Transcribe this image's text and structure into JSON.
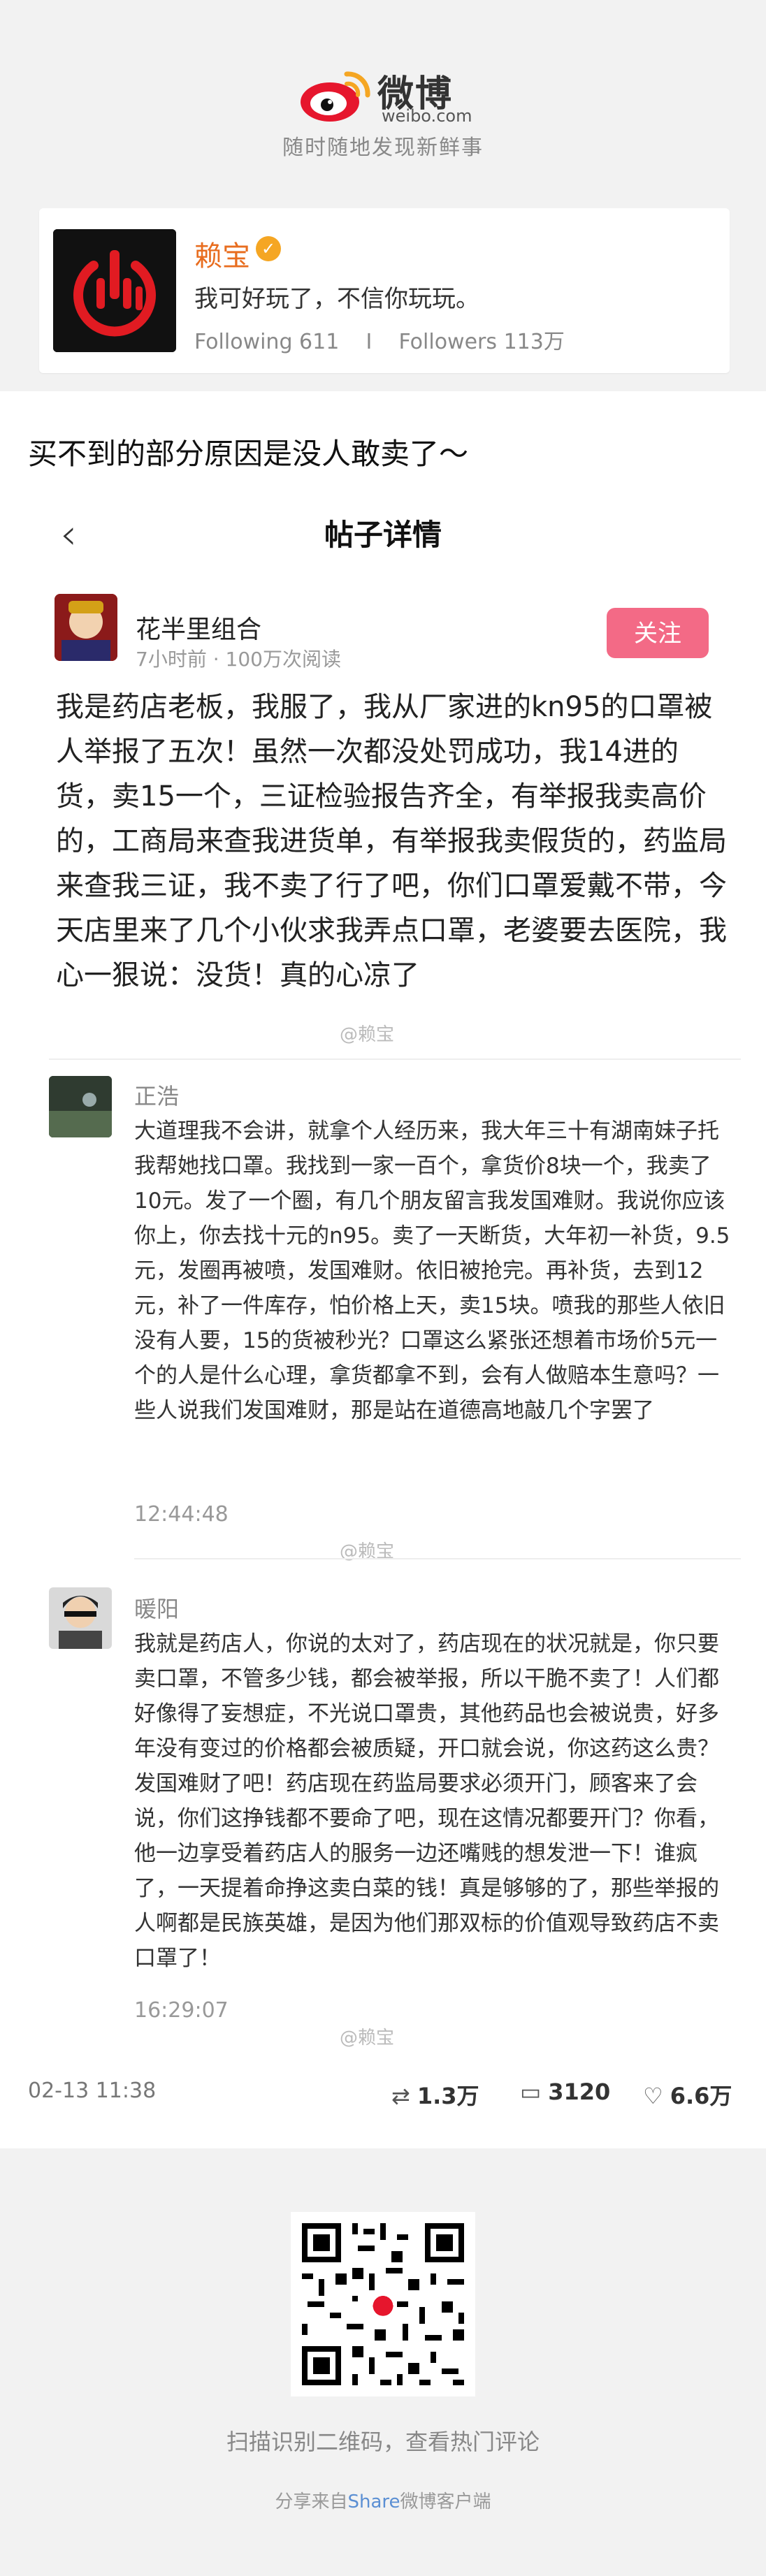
{
  "header": {
    "brand_word": "微博",
    "brand_domain": "weibo.com",
    "slogan": "随时随地发现新鲜事"
  },
  "profile": {
    "name": "赖宝",
    "verified_icon": "verified-badge-icon",
    "bio": "我可好玩了，不信你玩玩。",
    "following_label": "Following",
    "following_count": "611",
    "separator": "I",
    "followers_label": "Followers",
    "followers_count": "113万"
  },
  "post": {
    "headline": "买不到的部分原因是没人敢卖了～",
    "nav_back_icon": "chevron-left-icon",
    "nav_title": "帖子详情",
    "op": {
      "name": "花半里组合",
      "meta": "7小时前 · 100万次阅读",
      "follow_label": "关注",
      "body": "我是药店老板，我服了，我从厂家进的kn95的口罩被人举报了五次！虽然一次都没处罚成功，我14进的货，卖15一个，三证检验报告齐全，有举报我卖高价的，工商局来查我进货单，有举报我卖假货的，药监局来查我三证，我不卖了行了吧，你们口罩爱戴不带，今天店里来了几个小伙求我弄点口罩，老婆要去医院，我心一狠说：没货！真的心凉了"
    },
    "watermark": "@赖宝",
    "comments": [
      {
        "name": "正浩",
        "body": "大道理我不会讲，就拿个人经历来，我大年三十有湖南妹子托我帮她找口罩。我找到一家一百个，拿货价8块一个，我卖了10元。发了一个圈，有几个朋友留言我发国难财。我说你应该你上，你去找十元的n95。卖了一天断货，大年初一补货，9.5元，发圈再被喷，发国难财。依旧被抢完。再补货，去到12元，补了一件库存，怕价格上天，卖15块。喷我的那些人依旧没有人要，15的货被秒光？口罩这么紧张还想着市场价5元一个的人是什么心理，拿货都拿不到，会有人做赔本生意吗？一些人说我们发国难财，那是站在道德高地敲几个字罢了",
        "time": "12:44:48"
      },
      {
        "name": "暖阳",
        "body": "我就是药店人，你说的太对了，药店现在的状况就是，你只要卖口罩，不管多少钱，都会被举报，所以干脆不卖了！人们都好像得了妄想症，不光说口罩贵，其他药品也会被说贵，好多年没有变过的价格都会被质疑，开口就会说，你这药这么贵？发国难财了吧！药店现在药监局要求必须开门，顾客来了会说，你们这挣钱都不要命了吧，现在这情况都要开门？你看，他一边享受着药店人的服务一边还嘴贱的想发泄一下！谁疯了，一天提着命挣这卖白菜的钱！真是够够的了，那些举报的人啊都是民族英雄，是因为他们那双标的价值观导致药店不卖口罩了！",
        "time": "16:29:07"
      }
    ],
    "footer": {
      "date": "02-13 11:38",
      "repost_icon": "repost-icon",
      "reposts": "1.3万",
      "comment_icon": "comment-icon",
      "comments": "3120",
      "like_icon": "heart-icon",
      "likes": "6.6万"
    }
  },
  "bottom": {
    "qr_hint": "扫描识别二维码，查看热门评论",
    "share_prefix": "分享来自",
    "share_brand": "Share",
    "share_suffix": "微博客户端"
  },
  "colors": {
    "accent_orange": "#e86d1f",
    "follow_pink": "#f36a86",
    "brand_red": "#e6162d",
    "brand_yellow": "#f5a623",
    "link_blue": "#5b8fd3"
  }
}
